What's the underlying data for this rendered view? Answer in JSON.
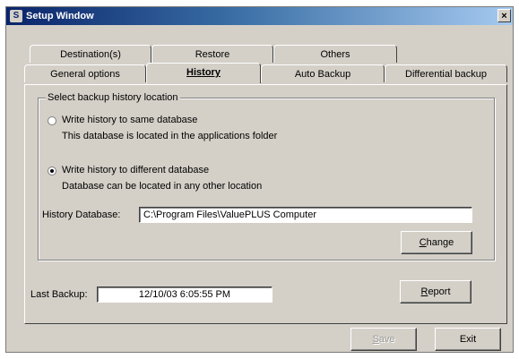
{
  "window": {
    "title": "Setup Window",
    "close_glyph": "×"
  },
  "tabs_back": [
    {
      "label": "Destination(s)"
    },
    {
      "label": "Restore"
    },
    {
      "label": "Others"
    }
  ],
  "tabs_front": [
    {
      "label": "General options"
    },
    {
      "label": "History",
      "active": true
    },
    {
      "label": "Auto Backup"
    },
    {
      "label": "Differential backup"
    }
  ],
  "history": {
    "group_title": "Select backup history location",
    "option_same": {
      "label": "Write history to same database",
      "description": "This database is located in the applications folder",
      "checked": false
    },
    "option_different": {
      "label": "Write history to different database",
      "description": "Database  can be located in any other location",
      "checked": true
    },
    "db_label": "History Database:",
    "db_path": "C:\\Program Files\\ValuePLUS Computer",
    "change_button": "Change"
  },
  "last_backup": {
    "label": "Last Backup:",
    "value": "12/10/03 6:05:55 PM"
  },
  "report_button": "Report",
  "footer": {
    "save_button": "Save",
    "exit_button": "Exit"
  },
  "icons": {
    "app": "setup-app-icon",
    "close": "close-icon",
    "radio": "radio-button"
  }
}
